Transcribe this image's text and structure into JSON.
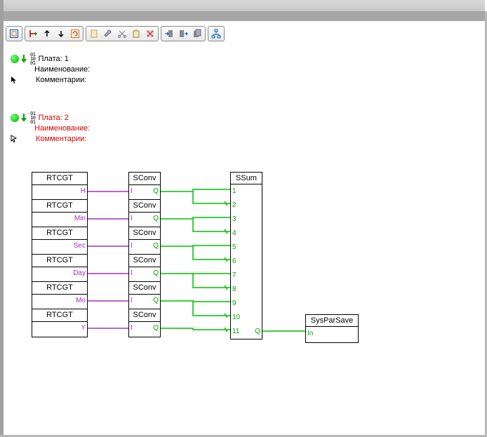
{
  "plate1": {
    "title": "Плата: 1",
    "name_lbl": "Наименование:",
    "comment_lbl": "Комментарии:"
  },
  "plate2": {
    "title": "Плата: 2",
    "name_lbl": "Наименование:",
    "comment_lbl": "Комментарии:"
  },
  "blocks": {
    "rtcgt": {
      "title": "RTCGT",
      "rows": [
        {
          "title": "RTCGT",
          "out": "H"
        },
        {
          "title": "RTCGT",
          "out": "Min"
        },
        {
          "title": "RTCGT",
          "out": "Sec"
        },
        {
          "title": "RTCGT",
          "out": "Day"
        },
        {
          "title": "RTCGT",
          "out": "Mo"
        },
        {
          "title": "RTCGT",
          "out": "Y"
        }
      ]
    },
    "sconv": {
      "title": "SConv",
      "rows": [
        {
          "title": "SConv",
          "in": "I",
          "out": "Q"
        },
        {
          "title": "SConv",
          "in": "I",
          "out": "Q"
        },
        {
          "title": "SConv",
          "in": "I",
          "out": "Q"
        },
        {
          "title": "SConv",
          "in": "I",
          "out": "Q"
        },
        {
          "title": "SConv",
          "in": "I",
          "out": "Q"
        },
        {
          "title": "SConv",
          "in": "I",
          "out": "Q"
        }
      ]
    },
    "ssum": {
      "title": "SSum",
      "pins_left": [
        "1",
        "2",
        "3",
        "4",
        "5",
        "6",
        "7",
        "8",
        "9",
        "10",
        "11"
      ],
      "out": "Q"
    },
    "syspar": {
      "title": "SysParSave",
      "in": "In"
    }
  }
}
